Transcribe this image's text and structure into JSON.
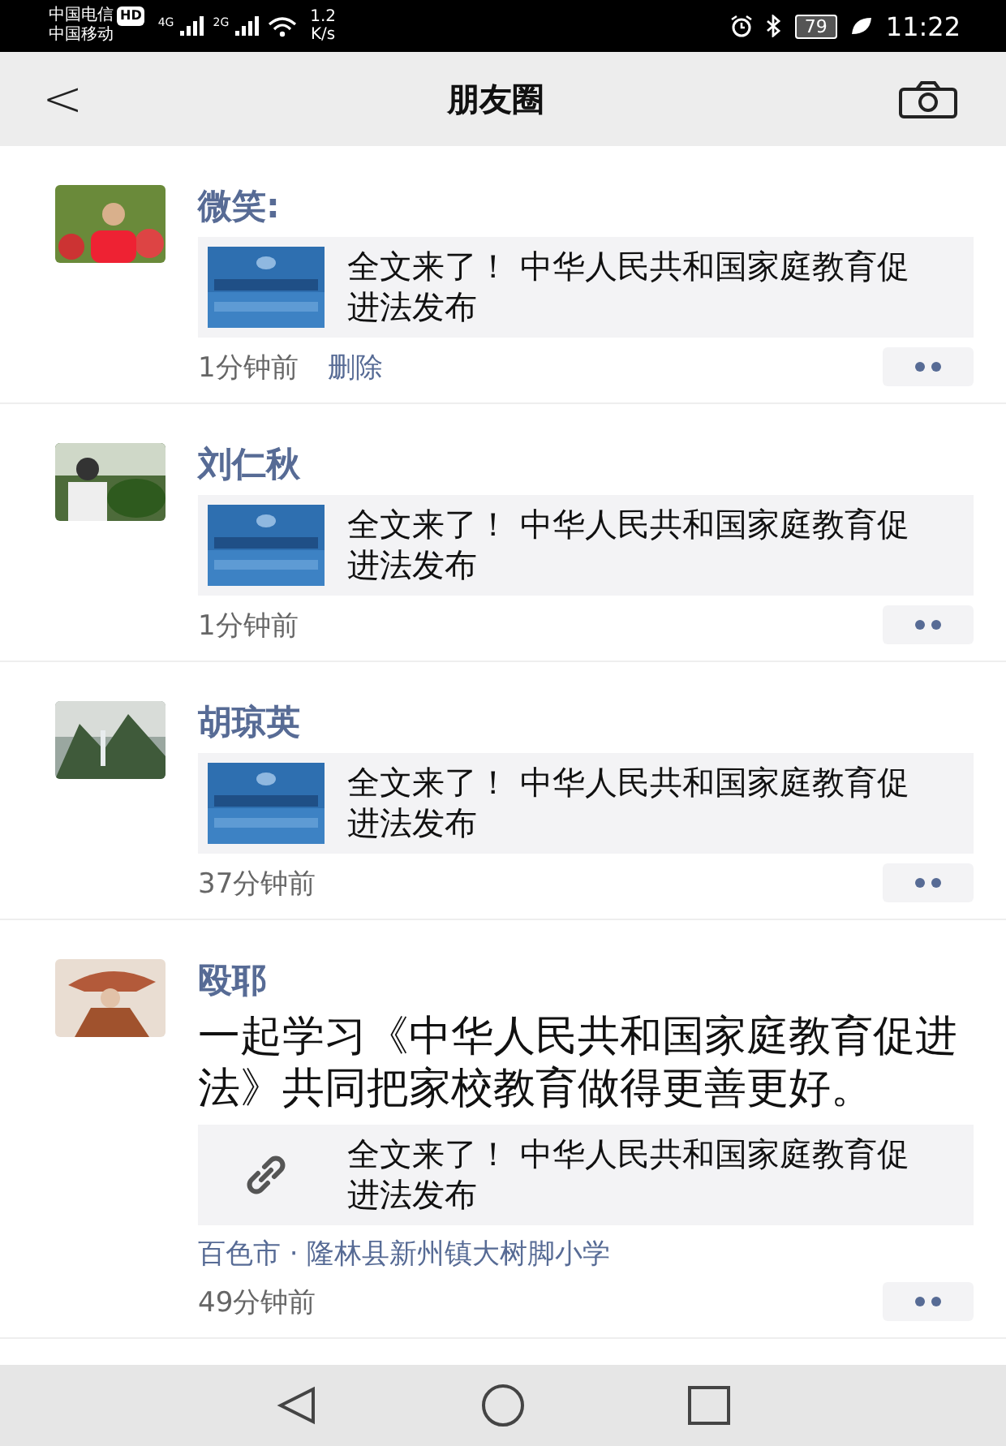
{
  "status_bar": {
    "carrier_1": "中国电信",
    "hd": "HD",
    "carrier_2": "中国移动",
    "net_1": "4G",
    "net_2": "2G",
    "speed": "1.2",
    "speed_unit": "K/s",
    "battery": "79",
    "time": "11:22"
  },
  "header": {
    "back": "<",
    "title": "朋友圈"
  },
  "posts": [
    {
      "name": "微笑:",
      "link": {
        "kind": "picture",
        "title": "全文来了！ 中华人民共和国家庭教育促进法发布"
      },
      "time": "1分钟前",
      "delete": "删除"
    },
    {
      "name": "刘仁秋",
      "link": {
        "kind": "picture",
        "title": "全文来了！ 中华人民共和国家庭教育促进法发布"
      },
      "time": "1分钟前"
    },
    {
      "name": "胡琼英",
      "link": {
        "kind": "picture",
        "title": "全文来了！ 中华人民共和国家庭教育促进法发布"
      },
      "time": "37分钟前"
    },
    {
      "name": "殴耶",
      "text": "一起学习《中华人民共和国家庭教育促进法》共同把家校教育做得更善更好。",
      "link": {
        "kind": "link",
        "title": "全文来了！ 中华人民共和国家庭教育促进法发布"
      },
      "location": "百色市 · 隆林县新州镇大树脚小学",
      "time": "49分钟前"
    }
  ]
}
